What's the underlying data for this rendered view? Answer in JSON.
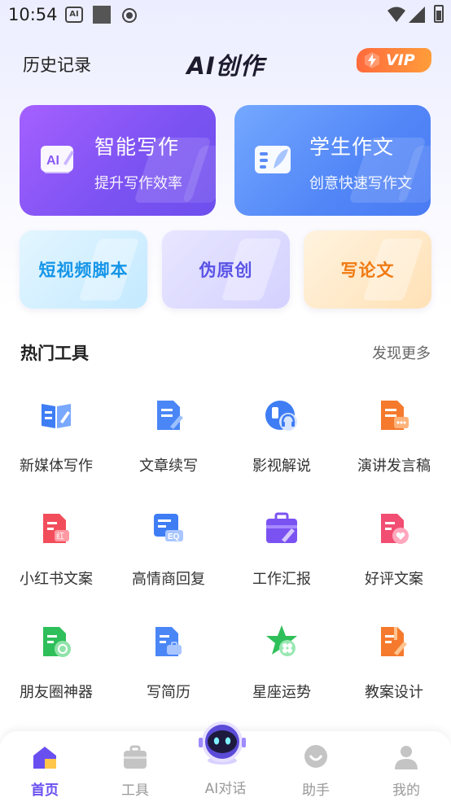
{
  "status_bar": {
    "time": "10:54",
    "ai_badge": "AI"
  },
  "header": {
    "history_label": "历史记录",
    "title": "AI创作",
    "vip_label": "VIP"
  },
  "feature_cards": [
    {
      "title": "智能写作",
      "subtitle": "提升写作效率",
      "icon": "ai-writing-icon"
    },
    {
      "title": "学生作文",
      "subtitle": "创意快速写作文",
      "icon": "student-essay-icon"
    }
  ],
  "quick_cards": [
    {
      "label": "短视频脚本"
    },
    {
      "label": "伪原创"
    },
    {
      "label": "写论文"
    }
  ],
  "hot_tools": {
    "title": "热门工具",
    "more_label": "发现更多",
    "items": [
      {
        "label": "新媒体写作",
        "icon": "open-book-icon"
      },
      {
        "label": "文章续写",
        "icon": "doc-edit-icon"
      },
      {
        "label": "影视解说",
        "icon": "headphones-icon"
      },
      {
        "label": "演讲发言稿",
        "icon": "speech-doc-icon"
      },
      {
        "label": "小红书文案",
        "icon": "red-note-icon"
      },
      {
        "label": "高情商回复",
        "icon": "eq-chat-icon"
      },
      {
        "label": "工作汇报",
        "icon": "briefcase-icon"
      },
      {
        "label": "好评文案",
        "icon": "heart-doc-icon"
      },
      {
        "label": "朋友圈神器",
        "icon": "moments-icon"
      },
      {
        "label": "写简历",
        "icon": "resume-icon"
      },
      {
        "label": "星座运势",
        "icon": "star-clover-icon"
      },
      {
        "label": "教案设计",
        "icon": "lesson-plan-icon"
      }
    ]
  },
  "bottom_nav": {
    "items": [
      {
        "label": "首页",
        "icon": "home-icon",
        "active": true
      },
      {
        "label": "工具",
        "icon": "toolbox-icon",
        "active": false
      },
      {
        "label": "AI对话",
        "icon": "robot-icon",
        "active": false
      },
      {
        "label": "助手",
        "icon": "assistant-icon",
        "active": false
      },
      {
        "label": "我的",
        "icon": "user-icon",
        "active": false
      }
    ]
  },
  "colors": {
    "accent": "#6a4ff0",
    "vip": "#ff7a3a",
    "card_purple": "#7b52f2",
    "card_blue": "#5286f7"
  }
}
